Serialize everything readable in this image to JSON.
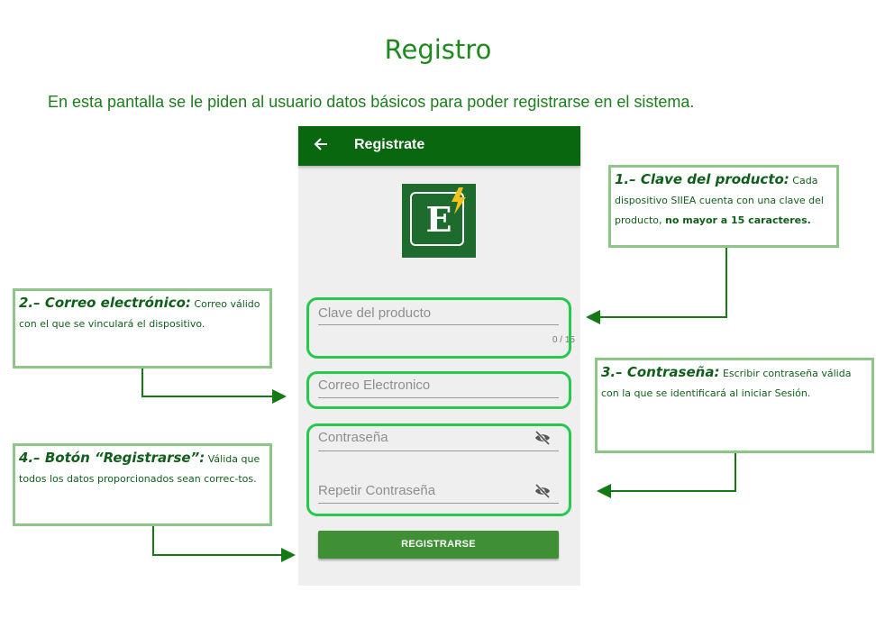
{
  "title": "Registro",
  "intro": "En esta pantalla se le piden al usuario datos básicos para poder registrarse en el sistema.",
  "app": {
    "appbar_title": "Registrate",
    "logo_letter": "E",
    "fields": {
      "clave": {
        "placeholder": "Clave del producto",
        "counter": "0 / 15"
      },
      "correo": {
        "placeholder": "Correo Electronico"
      },
      "contrasena": {
        "placeholder": "Contraseña"
      },
      "repetir": {
        "placeholder": "Repetir Contraseña"
      }
    },
    "register_button": "REGISTRARSE",
    "colors": {
      "appbar": "#08670f",
      "button": "#3f8f34",
      "highlight": "#26c94e"
    }
  },
  "callouts": {
    "c1": {
      "heading": "1.– Clave del producto:",
      "text": " Cada dispositivo SIIEA cuenta con una clave del producto, ",
      "bold": "no mayor a 15 caracteres."
    },
    "c2": {
      "heading": "2.– Correo electrónico:",
      "text": " Correo válido con el que se vinculará el dispositivo."
    },
    "c3": {
      "heading": "3.– Contraseña:",
      "text": " Escribir contraseña válida con la que se identificará al iniciar Sesión."
    },
    "c4": {
      "heading": "4.– Botón “Registrarse”:",
      "text": " Válida que todos los datos proporcionados sean correc-tos."
    }
  }
}
